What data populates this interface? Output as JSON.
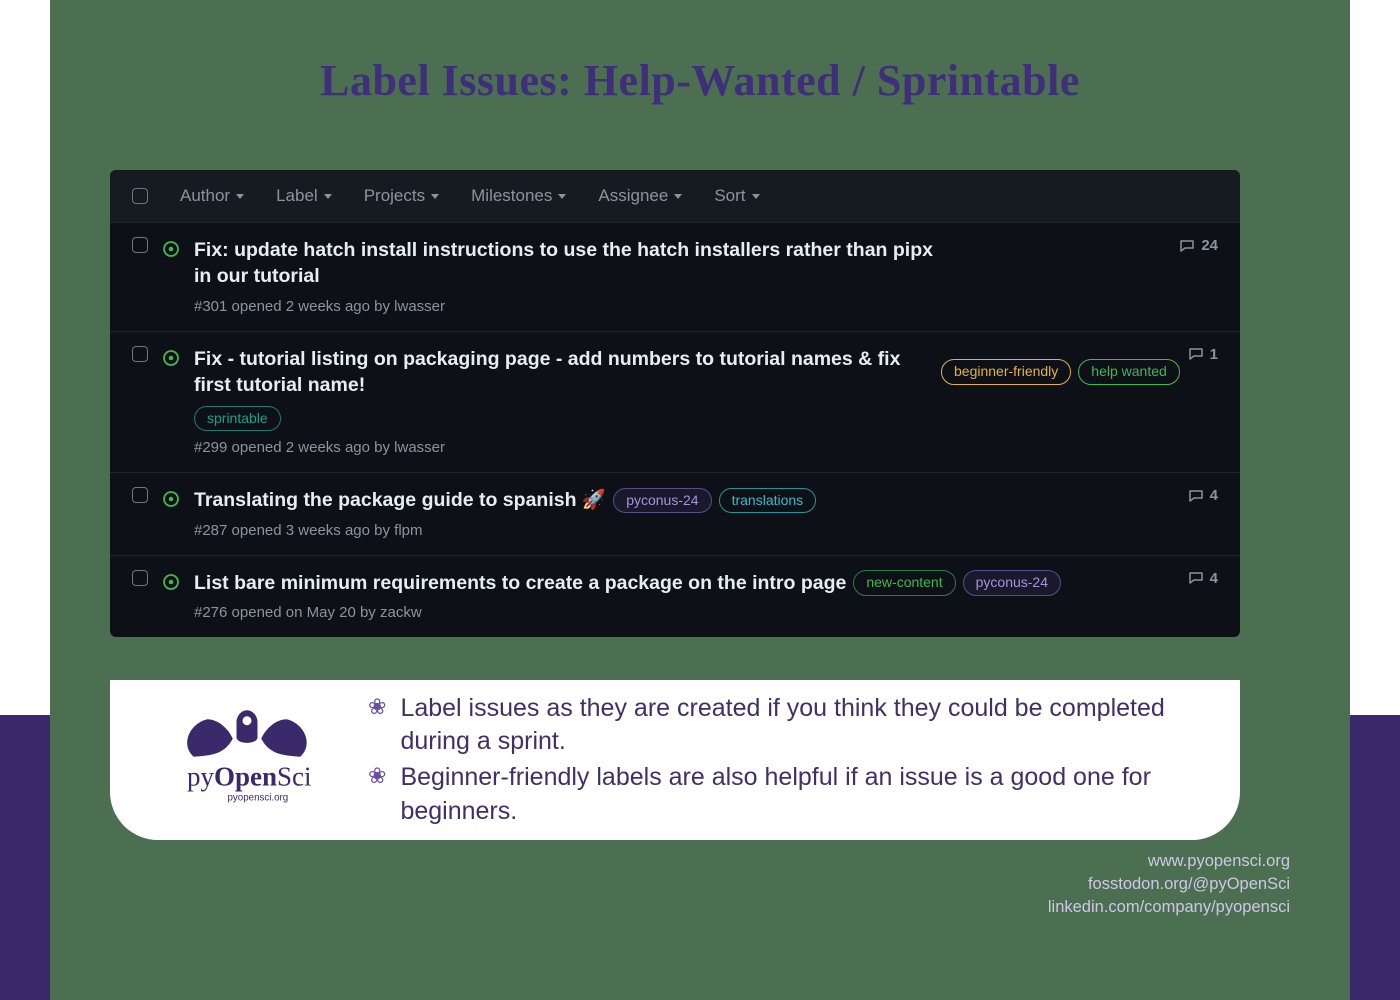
{
  "title": "Label Issues: Help-Wanted / Sprintable",
  "filters": [
    "Author",
    "Label",
    "Projects",
    "Milestones",
    "Assignee",
    "Sort"
  ],
  "issues": [
    {
      "title": "Fix: update hatch install instructions to use the hatch installers rather than pipx in our tutorial",
      "meta": "#301 opened 2 weeks ago by lwasser",
      "comments": "24",
      "labels": []
    },
    {
      "title": "Fix - tutorial listing on packaging page - add numbers to tutorial names & fix first tutorial name!",
      "meta": "#299 opened 2 weeks ago by lwasser",
      "comments": "1",
      "labels": [
        {
          "text": "beginner-friendly",
          "cls": "lbl-beginner"
        },
        {
          "text": "help wanted",
          "cls": "lbl-help"
        },
        {
          "text": "sprintable",
          "cls": "lbl-sprint"
        }
      ]
    },
    {
      "title": "Translating the package guide to spanish 🚀",
      "meta": "#287 opened 3 weeks ago by flpm",
      "comments": "4",
      "labels": [
        {
          "text": "pyconus-24",
          "cls": "lbl-pyconus"
        },
        {
          "text": "translations",
          "cls": "lbl-trans"
        }
      ]
    },
    {
      "title": "List bare minimum requirements to create a package on the intro page",
      "meta": "#276 opened on May 20 by zackw",
      "comments": "4",
      "labels": [
        {
          "text": "new-content",
          "cls": "lbl-newcontent"
        },
        {
          "text": "pyconus-24",
          "cls": "lbl-pyconus"
        }
      ]
    }
  ],
  "bullets": [
    "Label issues as they are created if you think they could be completed during a sprint.",
    "Beginner-friendly labels are also helpful if an issue is a good one for beginners."
  ],
  "logo": {
    "name": "pyOpenSci",
    "tag": "pyopensci.org"
  },
  "links": [
    "www.pyopensci.org",
    "fosstodon.org/@pyOpenSci",
    "linkedin.com/company/pyopensci"
  ]
}
